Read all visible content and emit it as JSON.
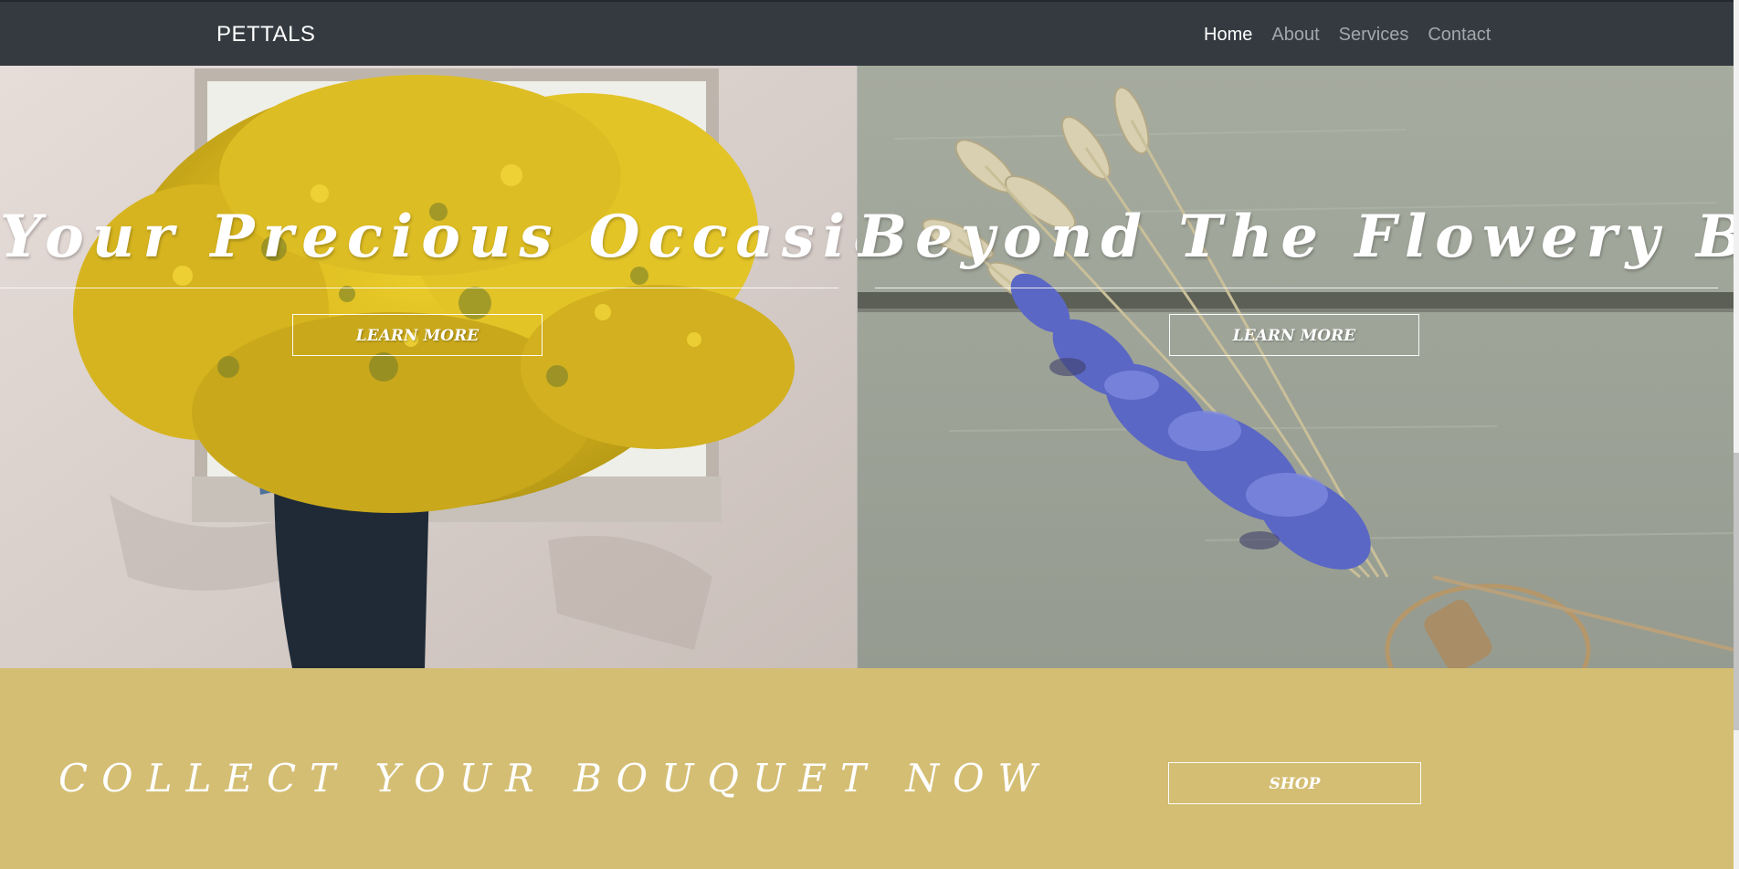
{
  "navbar": {
    "brand": "PETTALS",
    "links": [
      {
        "label": "Home",
        "active": true
      },
      {
        "label": "About",
        "active": false
      },
      {
        "label": "Services",
        "active": false
      },
      {
        "label": "Contact",
        "active": false
      }
    ]
  },
  "hero": {
    "left": {
      "title": "Your Precious Occasion",
      "button": "LEARN MORE"
    },
    "right": {
      "title": "Beyond The Flowery Bud",
      "button": "LEARN MORE"
    }
  },
  "cta": {
    "heading": "COLLECT YOUR BOUQUET NOW",
    "button": "SHOP"
  },
  "colors": {
    "navbar_bg": "#343a40",
    "cta_bg": "#d4be74",
    "mimosa_yellow": "#e2c323",
    "lavender": "#5b67c4",
    "wheat": "#d8d0b0"
  }
}
